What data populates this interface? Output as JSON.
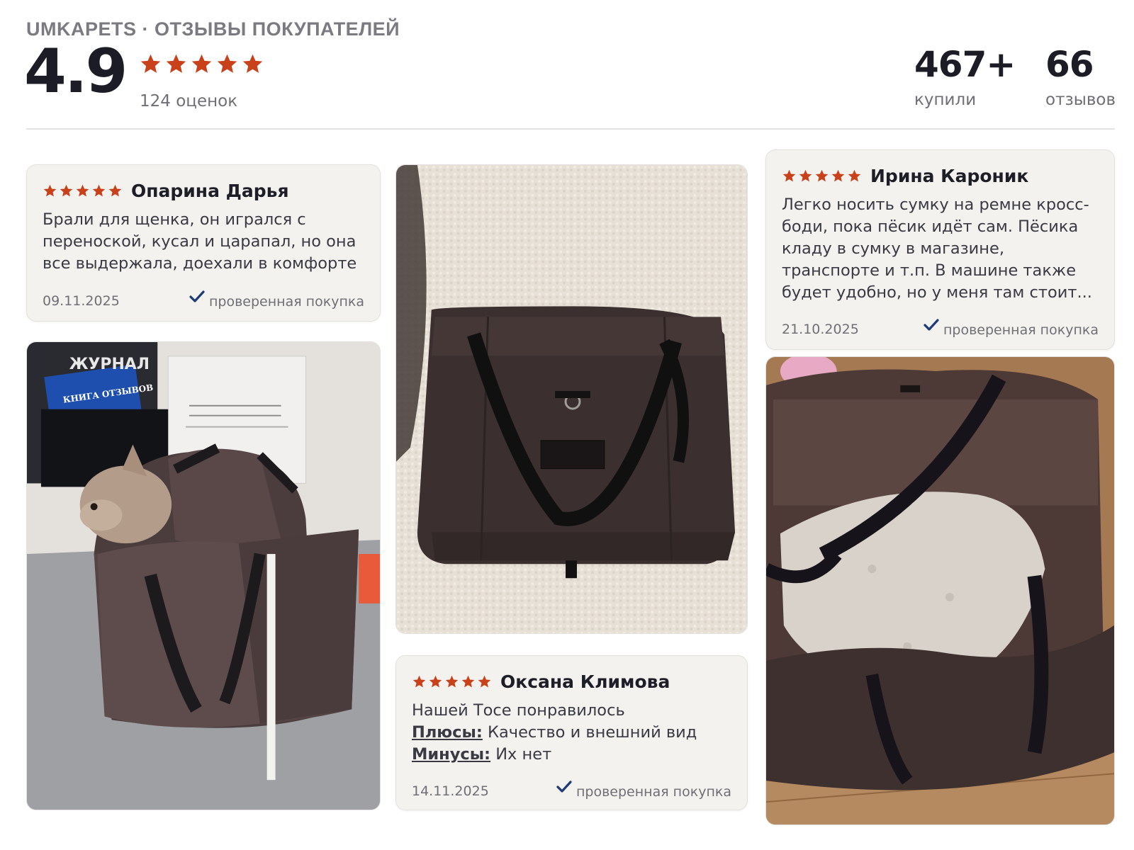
{
  "header": {
    "brand": "UMKAPETS · ОТЗЫВЫ ПОКУПАТЕЛЕЙ",
    "rating": "4.9",
    "stars": 5,
    "ratings_count": "124 оценок",
    "stats": [
      {
        "value": "467+",
        "label": "купили"
      },
      {
        "value": "66",
        "label": "отзывов"
      }
    ]
  },
  "colors": {
    "star": "#c8411a",
    "check": "#1e3a78"
  },
  "reviews": [
    {
      "author": "Опарина Дарья",
      "stars": 5,
      "text": "Брали для щенка, он игрался с переноской, кусал и царапал, но она все выдержала, доехали в комфорте",
      "date": "09.11.2025",
      "verified": "проверенная покупка"
    },
    {
      "author": "Оксана Климова",
      "stars": 5,
      "text": "Нашей Тосе понравилось",
      "pros_label": "Плюсы:",
      "pros": "Качество и внешний вид",
      "cons_label": "Минусы:",
      "cons": "Их нет",
      "date": "14.11.2025",
      "verified": "проверенная покупка"
    },
    {
      "author": "Ирина Кароник",
      "stars": 5,
      "text": "Легко носить сумку на ремне кросс-боди, пока пёсик идёт сам. Пёсика кладу в сумку в магазине, транспорте и т.п. В машине также будет удобно, но у меня там стоит...",
      "date": "21.10.2025",
      "verified": "проверенная покупка"
    }
  ],
  "photos": {
    "dog_photo": {
      "sign_top": "ЖУРНАЛ",
      "book_label": "КНИГА ОТЗЫВОВ"
    }
  }
}
